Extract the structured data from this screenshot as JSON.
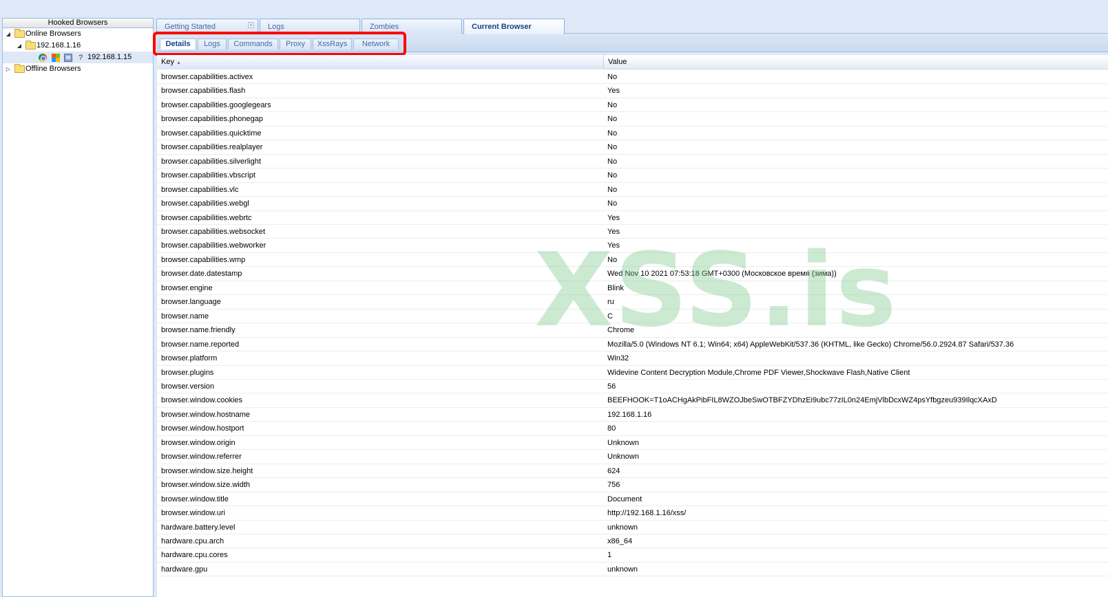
{
  "sidebar": {
    "title": "Hooked Browsers",
    "online_label": "Online Browsers",
    "host_label": "192.168.1.16",
    "browser_label": "192.168.1.15",
    "offline_label": "Offline Browsers"
  },
  "main_tabs": [
    {
      "label": "Getting Started"
    },
    {
      "label": "Logs"
    },
    {
      "label": "Zombies"
    },
    {
      "label": "Current Browser"
    }
  ],
  "sub_tabs": [
    {
      "label": "Details"
    },
    {
      "label": "Logs"
    },
    {
      "label": "Commands"
    },
    {
      "label": "Proxy"
    },
    {
      "label": "XssRays"
    },
    {
      "label": "Network"
    }
  ],
  "grid": {
    "columns": {
      "key": "Key",
      "value": "Value"
    },
    "rows": [
      {
        "key": "browser.capabilities.activex",
        "value": "No"
      },
      {
        "key": "browser.capabilities.flash",
        "value": "Yes"
      },
      {
        "key": "browser.capabilities.googlegears",
        "value": "No"
      },
      {
        "key": "browser.capabilities.phonegap",
        "value": "No"
      },
      {
        "key": "browser.capabilities.quicktime",
        "value": "No"
      },
      {
        "key": "browser.capabilities.realplayer",
        "value": "No"
      },
      {
        "key": "browser.capabilities.silverlight",
        "value": "No"
      },
      {
        "key": "browser.capabilities.vbscript",
        "value": "No"
      },
      {
        "key": "browser.capabilities.vlc",
        "value": "No"
      },
      {
        "key": "browser.capabilities.webgl",
        "value": "No"
      },
      {
        "key": "browser.capabilities.webrtc",
        "value": "Yes"
      },
      {
        "key": "browser.capabilities.websocket",
        "value": "Yes"
      },
      {
        "key": "browser.capabilities.webworker",
        "value": "Yes"
      },
      {
        "key": "browser.capabilities.wmp",
        "value": "No"
      },
      {
        "key": "browser.date.datestamp",
        "value": "Wed Nov 10 2021 07:53:18 GMT+0300 (Московское время (зима))"
      },
      {
        "key": "browser.engine",
        "value": "Blink"
      },
      {
        "key": "browser.language",
        "value": "ru"
      },
      {
        "key": "browser.name",
        "value": "C"
      },
      {
        "key": "browser.name.friendly",
        "value": "Chrome"
      },
      {
        "key": "browser.name.reported",
        "value": "Mozilla/5.0 (Windows NT 6.1; Win64; x64) AppleWebKit/537.36 (KHTML, like Gecko) Chrome/56.0.2924.87 Safari/537.36"
      },
      {
        "key": "browser.platform",
        "value": "Win32"
      },
      {
        "key": "browser.plugins",
        "value": "Widevine Content Decryption Module,Chrome PDF Viewer,Shockwave Flash,Native Client"
      },
      {
        "key": "browser.version",
        "value": "56"
      },
      {
        "key": "browser.window.cookies",
        "value": "BEEFHOOK=T1oACHgAkPibFIL8WZOJbeSwOTBFZYDhzEi9ubc77zIL0n24EmjVlbDcxWZ4psYfbgzeu939IlqcXAxD"
      },
      {
        "key": "browser.window.hostname",
        "value": "192.168.1.16"
      },
      {
        "key": "browser.window.hostport",
        "value": "80"
      },
      {
        "key": "browser.window.origin",
        "value": "Unknown"
      },
      {
        "key": "browser.window.referrer",
        "value": "Unknown"
      },
      {
        "key": "browser.window.size.height",
        "value": "624"
      },
      {
        "key": "browser.window.size.width",
        "value": "756"
      },
      {
        "key": "browser.window.title",
        "value": "Document"
      },
      {
        "key": "browser.window.uri",
        "value": "http://192.168.1.16/xss/"
      },
      {
        "key": "hardware.battery.level",
        "value": "unknown"
      },
      {
        "key": "hardware.cpu.arch",
        "value": "x86_64"
      },
      {
        "key": "hardware.cpu.cores",
        "value": "1"
      },
      {
        "key": "hardware.gpu",
        "value": "unknown"
      }
    ]
  },
  "watermark": "XSS.is"
}
